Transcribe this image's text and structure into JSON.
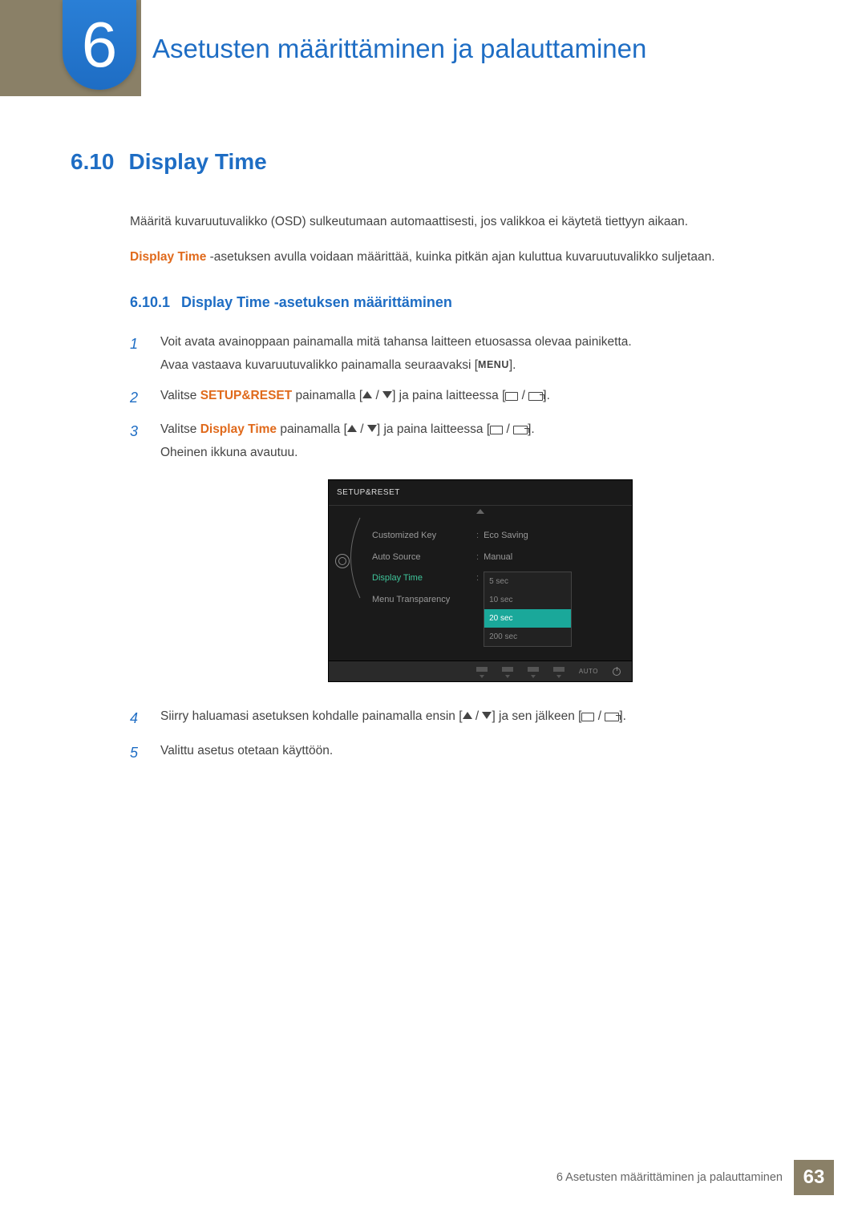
{
  "chapter": {
    "number": "6",
    "title": "Asetusten määrittäminen ja palauttaminen"
  },
  "section": {
    "number": "6.10",
    "title": "Display Time"
  },
  "intro1": "Määritä kuvaruutuvalikko (OSD) sulkeutumaan automaattisesti, jos valikkoa ei käytetä tiettyyn aikaan.",
  "intro2a": "Display Time",
  "intro2b": " -asetuksen avulla voidaan määrittää, kuinka pitkän ajan kuluttua kuvaruutuvalikko suljetaan.",
  "subsection": {
    "number": "6.10.1",
    "title": "Display Time -asetuksen määrittäminen"
  },
  "steps": {
    "s1": {
      "num": "1",
      "a": "Voit avata avainoppaan painamalla mitä tahansa laitteen etuosassa olevaa painiketta.",
      "b1": "Avaa vastaava kuvaruutuvalikko painamalla seuraavaksi [",
      "menu": "MENU",
      "b2": "]."
    },
    "s2": {
      "num": "2",
      "a": "Valitse ",
      "hl": "SETUP&RESET",
      "b": " painamalla [",
      "c": "] ja paina laitteessa [",
      "d": "]."
    },
    "s3": {
      "num": "3",
      "a": "Valitse ",
      "hl": "Display Time",
      "b": " painamalla [",
      "c": "] ja paina laitteessa [",
      "d": "].",
      "e": "Oheinen ikkuna avautuu."
    },
    "s4": {
      "num": "4",
      "a": "Siirry haluamasi asetuksen kohdalle painamalla ensin [",
      "b": "] ja sen jälkeen [",
      "c": "]."
    },
    "s5": {
      "num": "5",
      "a": "Valittu asetus otetaan käyttöön."
    }
  },
  "osd": {
    "title": "SETUP&RESET",
    "menu": {
      "m1": "Customized Key",
      "m2": "Auto Source",
      "m3": "Display Time",
      "m4": "Menu Transparency"
    },
    "vals": {
      "v1": "Eco Saving",
      "v2": "Manual"
    },
    "dropdown": {
      "o1": "5 sec",
      "o2": "10 sec",
      "o3": "20 sec",
      "o4": "200 sec"
    },
    "auto": "AUTO"
  },
  "footer": {
    "text": "6 Asetusten määrittäminen ja palauttaminen",
    "page": "63"
  }
}
